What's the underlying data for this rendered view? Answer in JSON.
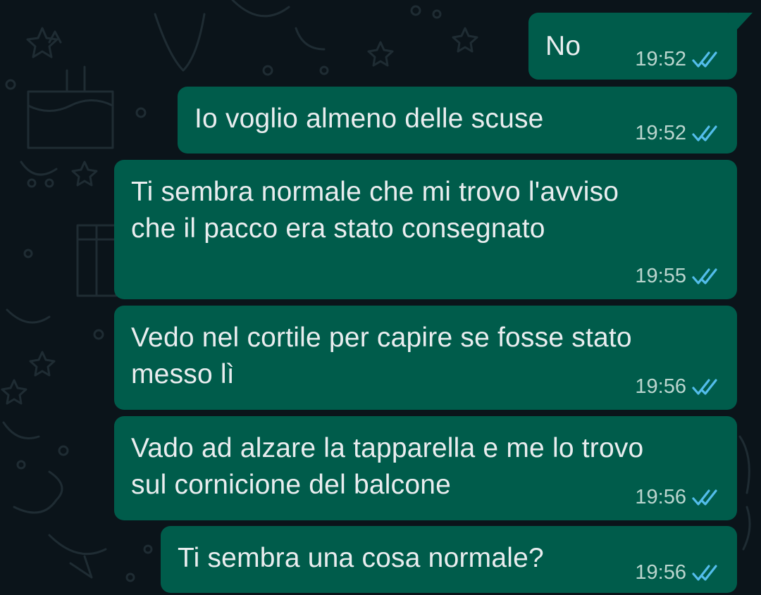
{
  "colors": {
    "background": "#0b141a",
    "bubble_outgoing": "#005c4b",
    "text": "#e9edef",
    "time": "#cfe3dd",
    "read_ticks": "#53bdeb"
  },
  "messages": [
    {
      "lines": [
        "No"
      ],
      "time": "19:52",
      "status": "read-double-check-icon"
    },
    {
      "lines": [
        "Io voglio almeno delle scuse"
      ],
      "time": "19:52",
      "status": "read-double-check-icon"
    },
    {
      "lines": [
        "Ti sembra normale che mi trovo l'avviso",
        "che il pacco era stato consegnato"
      ],
      "time": "19:55",
      "status": "read-double-check-icon"
    },
    {
      "lines": [
        "Vedo nel cortile per capire se fosse stato",
        "messo lì"
      ],
      "time": "19:56",
      "status": "read-double-check-icon"
    },
    {
      "lines": [
        "Vado ad alzare la tapparella e me lo trovo",
        "sul cornicione del balcone"
      ],
      "time": "19:56",
      "status": "read-double-check-icon"
    },
    {
      "lines": [
        "Ti sembra una cosa normale?"
      ],
      "time": "19:56",
      "status": "read-double-check-icon"
    }
  ]
}
